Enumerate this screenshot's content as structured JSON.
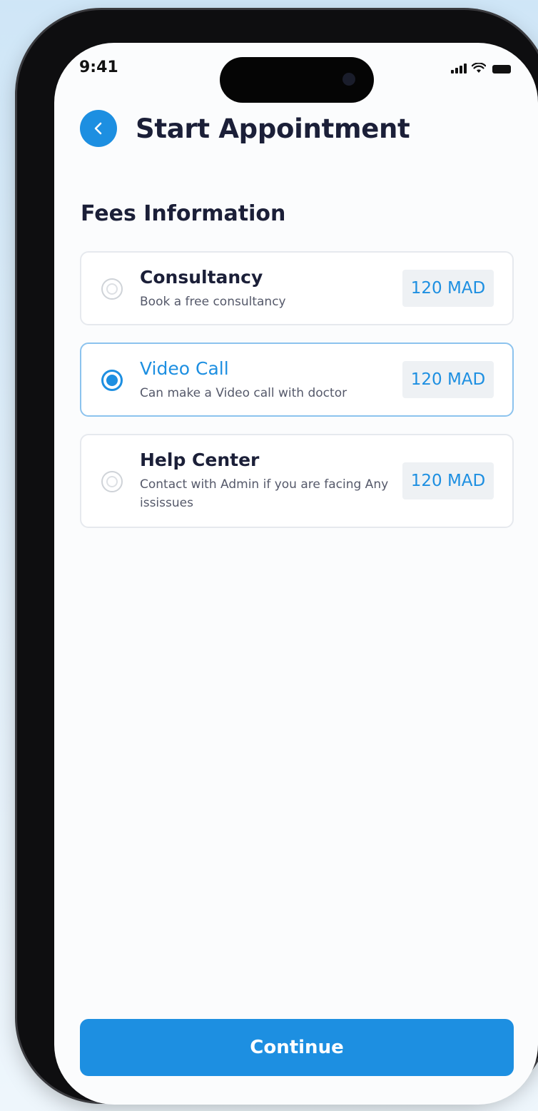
{
  "status_bar": {
    "time": "9:41"
  },
  "header": {
    "back_icon": "chevron-left-icon",
    "title": "Start Appointment"
  },
  "fees": {
    "section_title": "Fees Information",
    "options": [
      {
        "title": "Consultancy",
        "description": "Book a free consultancy",
        "price": "120 MAD",
        "selected": false
      },
      {
        "title": "Video Call",
        "description": "Can make a Video call with doctor",
        "price": "120 MAD",
        "selected": true
      },
      {
        "title": "Help Center",
        "description": "Contact with Admin if you are facing Any ississues",
        "price": "120 MAD",
        "selected": false
      }
    ]
  },
  "footer": {
    "continue_label": "Continue"
  },
  "colors": {
    "accent": "#1d8fe1",
    "text_dark": "#1b1f38",
    "price_bg": "#eef1f4"
  }
}
